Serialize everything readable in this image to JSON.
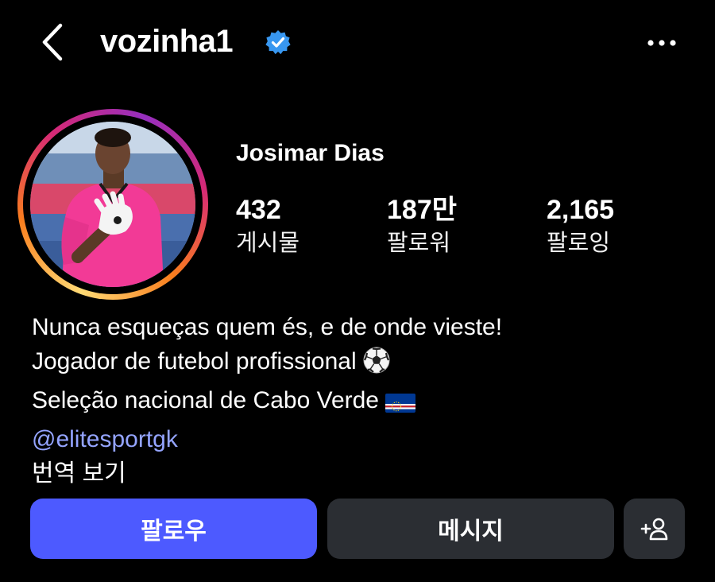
{
  "header": {
    "username": "vozinha1",
    "back_icon": "chevron-left-icon",
    "verified_icon": "verified-badge-icon",
    "more_icon": "more-horizontal-icon"
  },
  "profile": {
    "display_name": "Josimar Dias",
    "stats": [
      {
        "value": "432",
        "label": "게시물"
      },
      {
        "value": "187만",
        "label": "팔로워"
      },
      {
        "value": "2,165",
        "label": "팔로잉"
      }
    ]
  },
  "bio": {
    "line1": "Nunca esqueças quem és, e de onde vieste!",
    "line2": "Jogador de futebol profissional",
    "line3": "Seleção nacional de Cabo Verde",
    "link": "@elitesportgk",
    "translate": "번역 보기"
  },
  "actions": {
    "follow_label": "팔로우",
    "message_label": "메시지",
    "suggest_icon": "add-person-icon"
  },
  "colors": {
    "background": "#000000",
    "follow_button": "#4d5aff",
    "secondary_button": "#2b2e33",
    "verified_blue": "#3897f0",
    "link": "#94a4ff"
  }
}
